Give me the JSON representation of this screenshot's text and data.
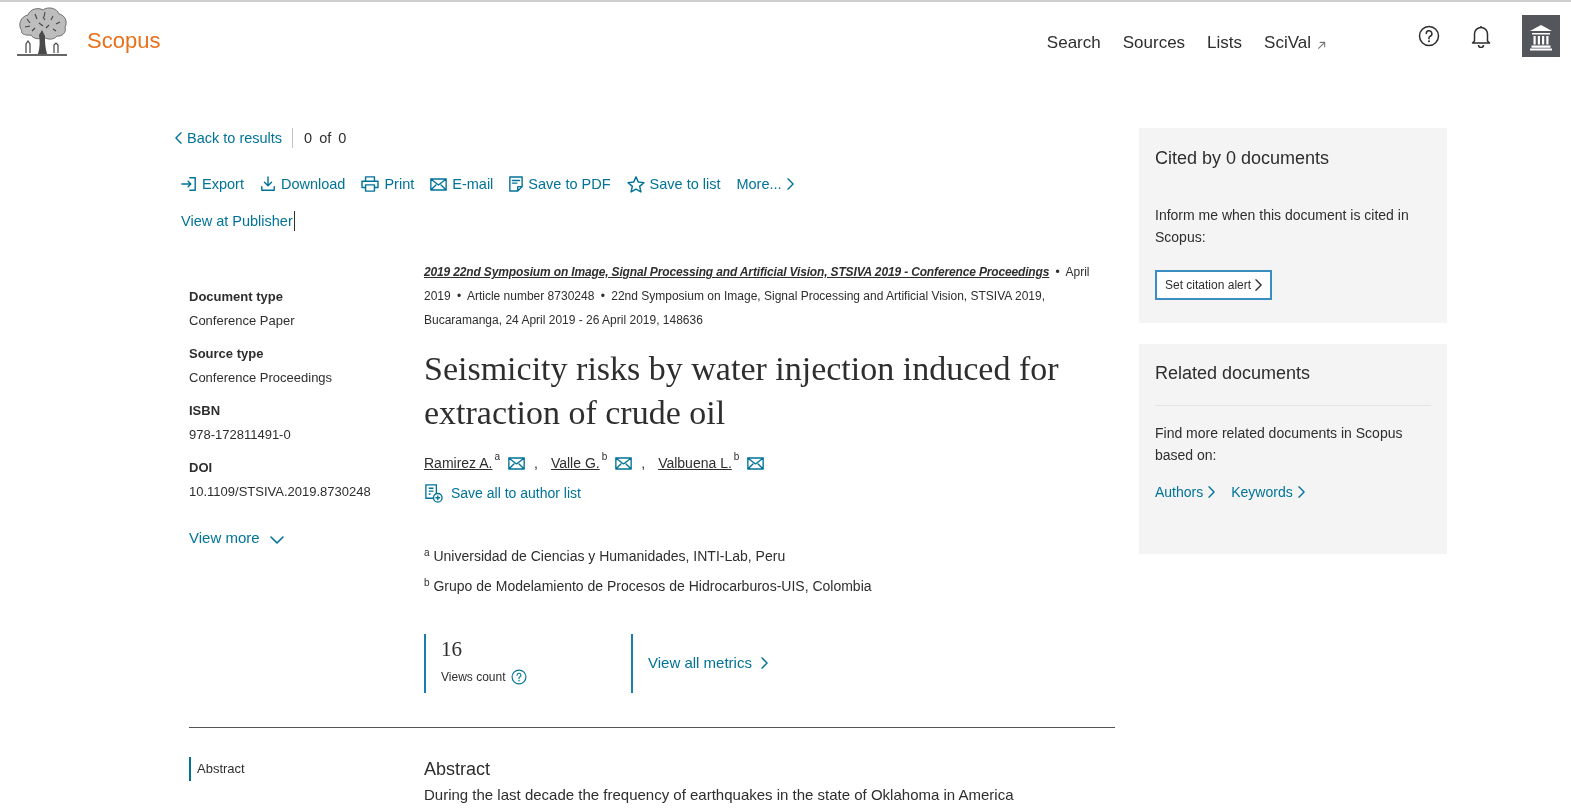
{
  "header": {
    "brand": "Scopus",
    "nav": [
      {
        "label": "Search",
        "external": false
      },
      {
        "label": "Sources",
        "external": false
      },
      {
        "label": "Lists",
        "external": false
      },
      {
        "label": "SciVal",
        "external": true
      }
    ]
  },
  "navigation": {
    "back": "Back to results",
    "position": "0 of 0"
  },
  "actions": [
    {
      "kind": "export",
      "label": "Export"
    },
    {
      "kind": "download",
      "label": "Download"
    },
    {
      "kind": "print",
      "label": "Print"
    },
    {
      "kind": "email",
      "label": "E-mail"
    },
    {
      "kind": "pdf",
      "label": "Save to PDF"
    },
    {
      "kind": "list",
      "label": "Save to list"
    },
    {
      "kind": "more",
      "label": "More..."
    }
  ],
  "view_at_publisher": "View at Publisher",
  "metadata": [
    {
      "label": "Document type",
      "value": "Conference Paper"
    },
    {
      "label": "Source type",
      "value": "Conference Proceedings"
    },
    {
      "label": "ISBN",
      "value": "978-172811491-0"
    },
    {
      "label": "DOI",
      "value": "10.1109/STSIVA.2019.8730248"
    }
  ],
  "view_more": "View more",
  "source": {
    "title": "2019 22nd Symposium on Image, Signal Processing and Artificial Vision, STSIVA 2019 - Conference Proceedings",
    "separator": "•",
    "details": [
      "April 2019",
      "Article number 8730248",
      "22nd Symposium on Image, Signal Processing and Artificial Vision, STSIVA 2019, Bucaramanga, 24 April 2019 - 26 April 2019, 148636"
    ]
  },
  "title": "Seismicity risks by water injection induced for extraction of crude oil",
  "authors": [
    {
      "name": "Ramirez A.",
      "affiliation": "a"
    },
    {
      "name": "Valle G.",
      "affiliation": "b"
    },
    {
      "name": "Valbuena L.",
      "affiliation": "b"
    }
  ],
  "author_separator": ",",
  "save_authors": "Save all to author list",
  "affiliations": [
    {
      "mark": "a",
      "text": "Universidad de Ciencias y Humanidades, INTI-Lab, Peru"
    },
    {
      "mark": "b",
      "text": "Grupo de Modelamiento de Procesos de Hidrocarburos-UIS, Colombia"
    }
  ],
  "metrics": {
    "value": "16",
    "label": "Views count",
    "link": "View all metrics"
  },
  "section_nav": [
    {
      "label": "Abstract",
      "selected": true
    }
  ],
  "abstract": {
    "heading": "Abstract",
    "text": "During the last decade the frequency of earthquakes in the state of Oklahoma in America"
  },
  "sidebar": {
    "cited": {
      "heading": "Cited by 0 documents",
      "text": "Inform me when this document is cited in Scopus:",
      "button": "Set citation alert"
    },
    "related": {
      "heading": "Related documents",
      "text": "Find more related documents in Scopus based on:",
      "links": [
        "Authors",
        "Keywords"
      ]
    }
  }
}
